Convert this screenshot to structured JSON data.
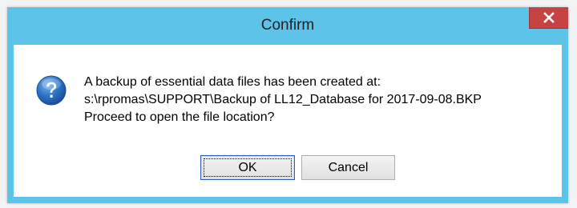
{
  "dialog": {
    "title": "Confirm",
    "close_label": "x",
    "message_lines": [
      "A backup of essential data files has been created at:",
      "s:\\rpromas\\SUPPORT\\Backup of LL12_Database for 2017-09-08.BKP",
      "Proceed to open the file location?"
    ],
    "icon": "question-icon",
    "buttons": {
      "ok_label": "OK",
      "cancel_label": "Cancel"
    }
  },
  "colors": {
    "titlebar": "#5ec3e9",
    "close_button": "#c74343",
    "icon_blue": "#2a6fc4",
    "client_background": "#ffffff"
  }
}
